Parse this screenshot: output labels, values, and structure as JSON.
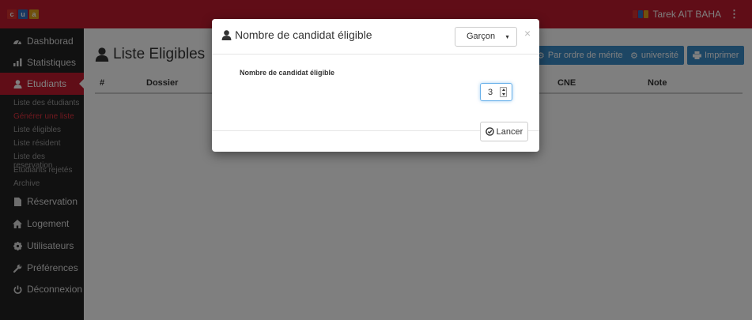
{
  "colors": {
    "brand": "#c11b2e",
    "sidebar": "#222222",
    "accent": "#3a8cc9",
    "active_sub": "#e2323f"
  },
  "topbar": {
    "logo_letters": [
      "c",
      "u",
      "a"
    ],
    "user_name": "Tarek AIT BAHA",
    "menu_dots": "⋮"
  },
  "sidebar": {
    "items": [
      {
        "label": "Dashborad",
        "icon": "dashboard-icon"
      },
      {
        "label": "Statistiques",
        "icon": "bar-chart-icon"
      },
      {
        "label": "Etudiants",
        "icon": "user-icon",
        "active": true
      },
      {
        "label": "Réservation",
        "icon": "file-icon"
      },
      {
        "label": "Logement",
        "icon": "home-icon"
      },
      {
        "label": "Utilisateurs",
        "icon": "gear-icon"
      },
      {
        "label": "Préférences",
        "icon": "wrench-icon"
      },
      {
        "label": "Déconnexion",
        "icon": "power-icon"
      }
    ],
    "sub_items": [
      {
        "label": "Liste des étudiants"
      },
      {
        "label": "Générer une liste",
        "current": true
      },
      {
        "label": "Liste éligibles"
      },
      {
        "label": "Liste résident"
      },
      {
        "label": "Liste des reservation"
      },
      {
        "label": "Etudiants rejetés"
      },
      {
        "label": "Archive"
      }
    ]
  },
  "main": {
    "title": "Liste Eligibles",
    "buttons": {
      "merit": "Par ordre de mérite",
      "universite": "université",
      "imprimer": "Imprimer"
    },
    "columns": [
      "#",
      "Dossier",
      "CNE",
      "Note"
    ]
  },
  "modal": {
    "title": "Nombre de candidat éligible",
    "select_value": "Garçon",
    "close": "×",
    "field_label": "Nombre de candidat éligible",
    "field_value": "3",
    "submit": "Lancer"
  }
}
